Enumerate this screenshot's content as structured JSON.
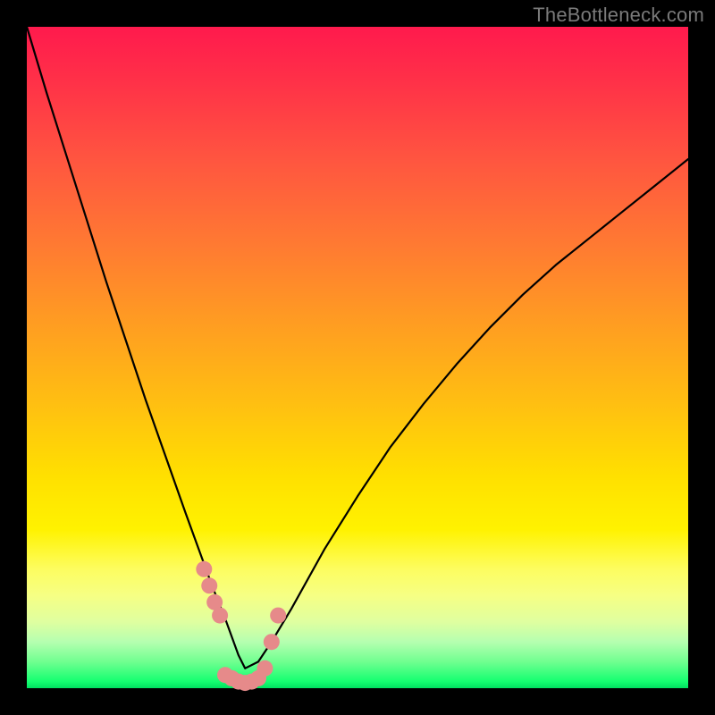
{
  "watermark": "TheBottleneck.com",
  "chart_data": {
    "type": "line",
    "title": "",
    "subtitle": "",
    "xlabel": "",
    "ylabel": "",
    "xlim": [
      0,
      100
    ],
    "ylim": [
      0,
      100
    ],
    "grid": false,
    "legend": null,
    "annotations": [],
    "tick_labels": {
      "x": [],
      "y": []
    },
    "background_gradient_top_to_bottom": [
      "#ff1a4d",
      "#ff7a32",
      "#ffe000",
      "#f6ff84",
      "#14ff70"
    ],
    "description": "Bottleneck-style chart: a single black V-shaped curve whose minimum (~0) lies around x≈33 on a 0–100 horizontal scale. Bottleneck percent rises steeply to ~100 at x≈0 and more gradually toward ~80 at x≈100. A cluster of salmon dots marks the low region around the minimum (x≈27–38, y≈0–11).",
    "series": [
      {
        "name": "bottleneck-curve",
        "color": "#000000",
        "x": [
          0,
          3,
          6,
          9,
          12,
          15,
          18,
          21,
          24,
          26,
          28,
          30,
          32,
          33,
          35,
          37,
          40,
          45,
          50,
          55,
          60,
          65,
          70,
          75,
          80,
          85,
          90,
          95,
          100
        ],
        "values": [
          100,
          90,
          80.5,
          71,
          61.5,
          52.5,
          43.5,
          35,
          26.5,
          21,
          15.5,
          10.5,
          5,
          3,
          4,
          7,
          12,
          21,
          29,
          36.5,
          43,
          49,
          54.5,
          59.5,
          64,
          68,
          72,
          76,
          80
        ]
      }
    ],
    "marker_points": {
      "name": "highlight-dots",
      "color": "#e68a8a",
      "x": [
        26.8,
        27.6,
        28.4,
        29.2,
        30.0,
        31.0,
        32.0,
        33.0,
        34.0,
        35.0,
        36.0,
        37.0,
        38.0
      ],
      "y": [
        18.0,
        15.5,
        13.0,
        11.0,
        2.0,
        1.5,
        1.0,
        0.8,
        1.0,
        1.5,
        3.0,
        7.0,
        11.0
      ]
    }
  },
  "colors": {
    "frame": "#000000",
    "curve": "#000000",
    "markers": "#e88b8b",
    "watermark": "#7a7a7a"
  }
}
